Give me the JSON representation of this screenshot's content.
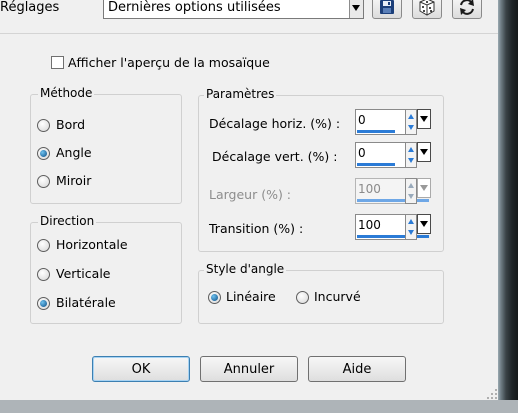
{
  "header": {
    "presets_label": "Réglages",
    "preset_value": "Dernières options utilisées",
    "toolbar_icons": [
      "save-icon",
      "dice-icon",
      "reset-icon"
    ]
  },
  "preview": {
    "label": "Afficher l'aperçu de la mosaïque",
    "checked": false
  },
  "methode": {
    "title": "Méthode",
    "options": [
      {
        "label": "Bord",
        "selected": false
      },
      {
        "label": "Angle",
        "selected": true
      },
      {
        "label": "Miroir",
        "selected": false
      }
    ]
  },
  "direction": {
    "title": "Direction",
    "options": [
      {
        "label": "Horizontale",
        "selected": false
      },
      {
        "label": "Verticale",
        "selected": false
      },
      {
        "label": "Bilatérale",
        "selected": true
      }
    ]
  },
  "parametres": {
    "title": "Paramètres",
    "fields": [
      {
        "label": "Décalage horiz. (%) :",
        "value": "0",
        "enabled": true
      },
      {
        "label": "Décalage vert. (%) :",
        "value": "0",
        "enabled": true
      },
      {
        "label": "Largeur (%) :",
        "value": "100",
        "enabled": false
      },
      {
        "label": "Transition (%) :",
        "value": "100",
        "enabled": true
      }
    ]
  },
  "style_angle": {
    "title": "Style d'angle",
    "options": [
      {
        "label": "Linéaire",
        "selected": true
      },
      {
        "label": "Incurvé",
        "selected": false
      }
    ]
  },
  "buttons": {
    "ok": "OK",
    "cancel": "Annuler",
    "help": "Aide"
  },
  "colors": {
    "accent": "#2b7bd6",
    "radio_selected": "#0a4d86",
    "dialog_bg": "#f0f0f0"
  }
}
